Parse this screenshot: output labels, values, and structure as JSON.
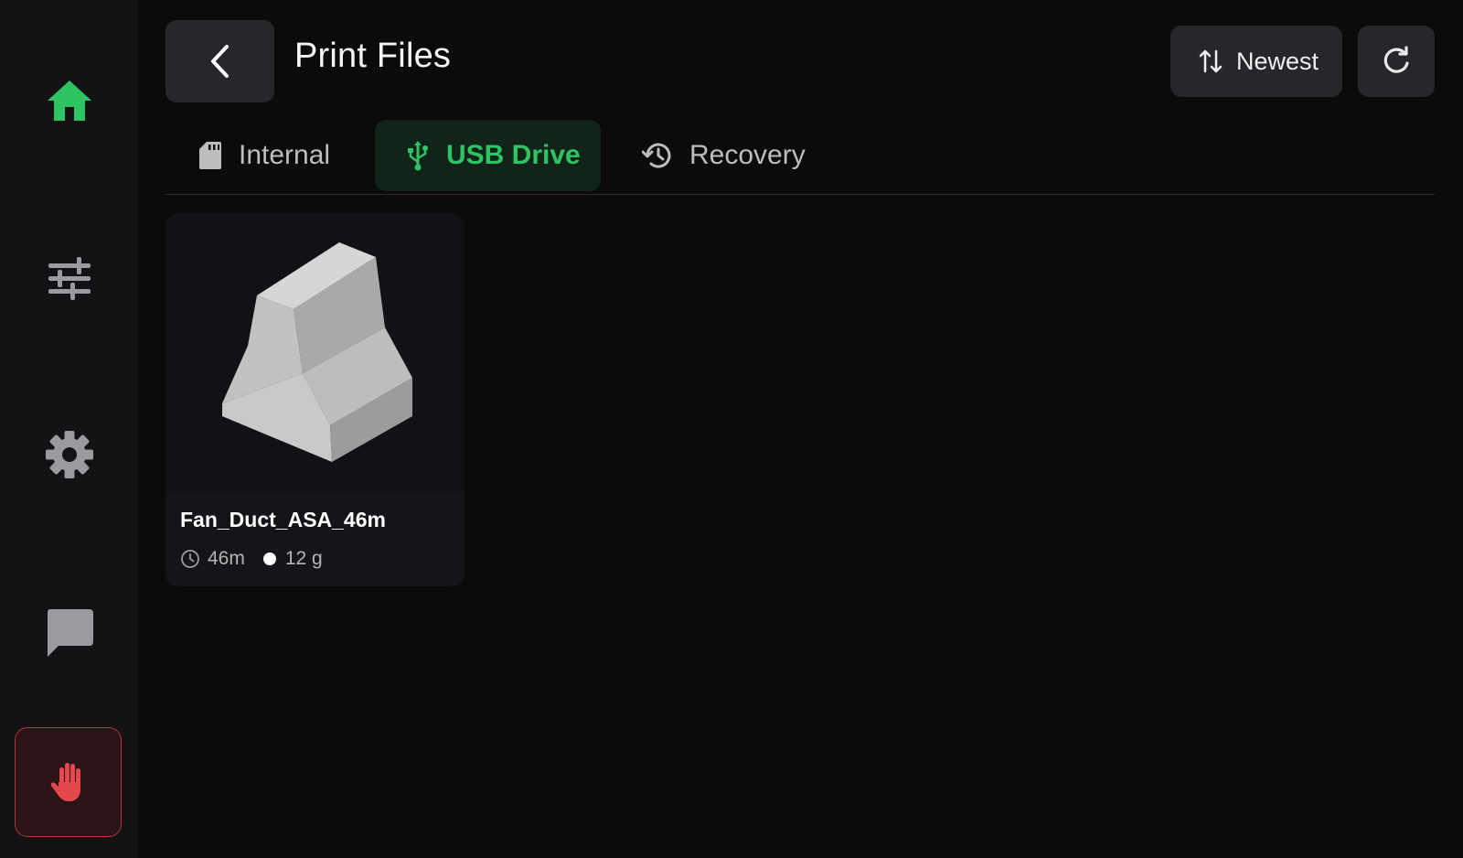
{
  "header": {
    "title": "Print Files",
    "sort_label": "Newest"
  },
  "tabs": [
    {
      "label": "Internal",
      "active": false
    },
    {
      "label": "USB Drive",
      "active": true
    },
    {
      "label": "Recovery",
      "active": false
    }
  ],
  "files": [
    {
      "name": "Fan_Duct_ASA_46m",
      "time": "46m",
      "weight": "12 g"
    }
  ],
  "icons": {
    "sidebar": [
      "home-icon",
      "sliders-icon",
      "gear-icon",
      "message-icon",
      "hand-stop-icon"
    ],
    "header": [
      "chevron-left-icon",
      "sort-icon",
      "refresh-icon"
    ],
    "tabs": [
      "sd-card-icon",
      "usb-icon",
      "history-icon"
    ],
    "meta": [
      "clock-icon"
    ]
  },
  "colors": {
    "accent": "#2fc463",
    "danger": "#e5484d",
    "background": "#0b0b0c",
    "sidebar": "#131316"
  }
}
